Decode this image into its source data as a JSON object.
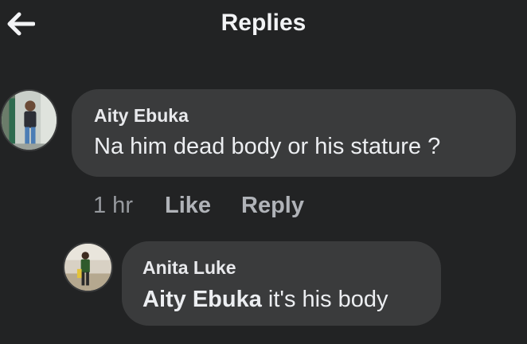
{
  "header": {
    "title": "Replies",
    "back_icon": "arrow-left-icon"
  },
  "comment": {
    "author": "Aity Ebuka",
    "text": "Na him dead body or his stature ?",
    "timestamp": "1 hr",
    "like_label": "Like",
    "reply_label": "Reply"
  },
  "reply": {
    "author": "Anita Luke",
    "mention": "Aity Ebuka",
    "text": " it's his body"
  },
  "colors": {
    "background": "#222324",
    "bubble": "#3a3b3c",
    "text": "#e4e6eb",
    "muted": "#b0b3b8"
  }
}
